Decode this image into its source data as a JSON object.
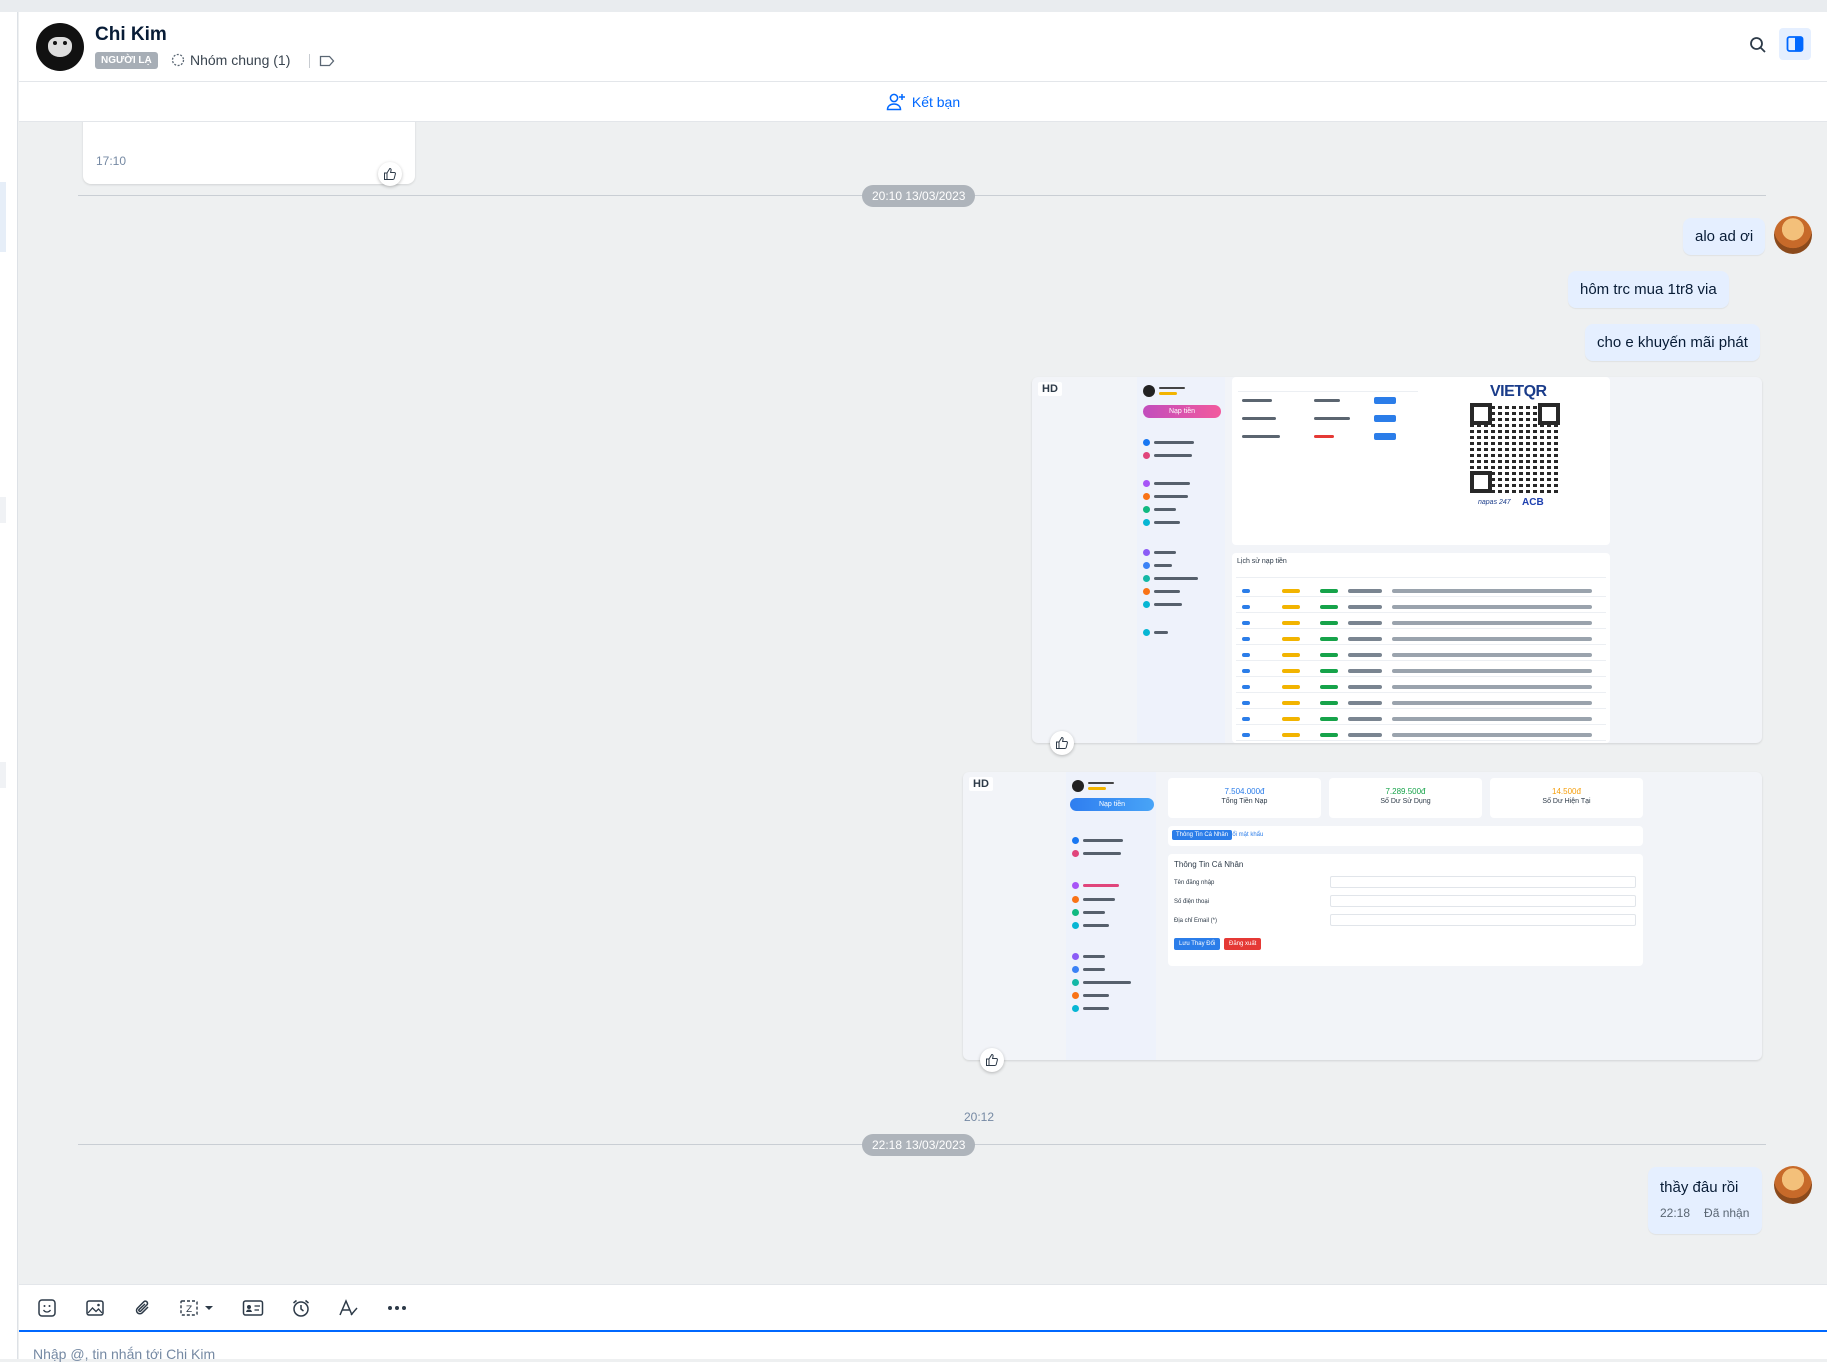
{
  "header": {
    "name": "Chi Kim",
    "badge": "NGƯỜI LẠ",
    "group_label": "Nhóm chung (1)"
  },
  "friend_bar": {
    "label": "Kết bạn"
  },
  "messages": {
    "old_time": "17:10",
    "divider1": "20:10 13/03/2023",
    "m1": "alo ad ơi",
    "m2": "hôm trc mua 1tr8 via",
    "m3": "cho e khuyến mãi phát",
    "hd1": "HD",
    "hd2": "HD",
    "img_time": "20:12",
    "divider2": "22:18 13/03/2023",
    "m4": "thầy đâu rồi",
    "m4_time": "22:18",
    "m4_status": "Đã nhận"
  },
  "screenshot1": {
    "nap_tien": "Nạp tiền",
    "vietqr": "VIETQR",
    "napas": "napas 247",
    "acb": "ACB",
    "history_title": "Lịch sử nạp tiền"
  },
  "screenshot2": {
    "nap_tien": "Nạp tiền",
    "stat1_value": "7.504.000đ",
    "stat1_label": "Tổng Tiền Nạp",
    "stat2_value": "7.289.500đ",
    "stat2_label": "Số Dư Sử Dụng",
    "stat3_value": "14.500đ",
    "stat3_label": "Số Dư Hiện Tại",
    "tab1": "Thông Tin Cá Nhân",
    "tab2": "Đổi mật khẩu",
    "section_title": "Thông Tin Cá Nhân",
    "field1": "Tên đăng nhập",
    "field2": "Số điện thoại",
    "field3": "Địa chỉ Email (*)",
    "save": "Lưu Thay Đổi",
    "logout": "Đăng xuất"
  },
  "input": {
    "placeholder": "Nhập @, tin nhắn tới Chi Kim"
  },
  "colors": {
    "accent": "#0068ff",
    "bubble_me": "#e5efff",
    "chat_bg": "#eef0f1"
  }
}
